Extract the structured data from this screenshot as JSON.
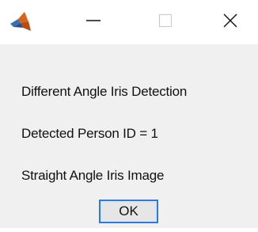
{
  "window": {
    "app_icon": "matlab-icon",
    "controls": {
      "minimize_icon": "minimize-icon",
      "maximize_icon": "maximize-icon",
      "close_icon": "close-icon"
    }
  },
  "dialog": {
    "messages": [
      "Different Angle Iris Detection",
      "Detected Person ID = 1",
      "Straight Angle Iris Image"
    ],
    "ok_label": "OK"
  },
  "colors": {
    "titlebar_bg": "#ffffff",
    "client_bg": "#f0f0f0",
    "button_focus_border": "#2f7ad6",
    "button_bg": "#e6e6e6",
    "disabled_glyph": "#cccccc"
  }
}
